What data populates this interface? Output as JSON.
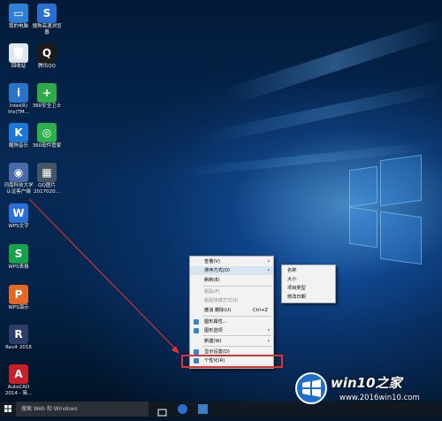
{
  "desktop": {
    "icons": [
      {
        "label": "我的电脑",
        "color": "#2f7fd6",
        "glyph": "▭",
        "icon": "computer-icon"
      },
      {
        "label": "搜狗高速浏览\n器",
        "color": "#2a6fd0",
        "glyph": "S",
        "icon": "sogou-browser-icon"
      },
      {
        "label": "回收站",
        "color": "#dfe6ee",
        "glyph": "🗑",
        "icon": "recycle-bin-icon"
      },
      {
        "label": "腾讯QQ",
        "color": "#1b1b1b",
        "glyph": "Q",
        "icon": "qq-icon"
      },
      {
        "label": "Intel(R)\nIris(TM...",
        "color": "#2a74c8",
        "glyph": "i",
        "icon": "intel-graphics-icon"
      },
      {
        "label": "360安全卫士",
        "color": "#2fa84a",
        "glyph": "+",
        "icon": "360-safe-icon"
      },
      {
        "label": "酷狗音乐",
        "color": "#1c78d6",
        "glyph": "K",
        "icon": "kugou-music-icon"
      },
      {
        "label": "360软件管家",
        "color": "#2fb04c",
        "glyph": "◎",
        "icon": "360-software-icon"
      },
      {
        "label": "河南科技大学\n认证客户端",
        "color": "#4a6aa8",
        "glyph": "◉",
        "icon": "campus-client-icon"
      },
      {
        "label": "QQ图片\n2017020...",
        "color": "#445566",
        "glyph": "▦",
        "icon": "qq-image-icon"
      },
      {
        "label": "WPS文字",
        "color": "#2b6fd8",
        "glyph": "W",
        "icon": "wps-writer-icon"
      },
      {
        "label": "WPS表格",
        "color": "#17a34a",
        "glyph": "S",
        "icon": "wps-spreadsheet-icon"
      },
      {
        "label": "WPS演示",
        "color": "#e2692a",
        "glyph": "P",
        "icon": "wps-presentation-icon"
      },
      {
        "label": "Revit 2016",
        "color": "#2a3e6a",
        "glyph": "R",
        "icon": "revit-icon"
      },
      {
        "label": "AutoCAD\n2014 - 简...",
        "color": "#c8202a",
        "glyph": "A",
        "icon": "autocad-icon"
      }
    ]
  },
  "context_menu": {
    "items": [
      {
        "label": "查看(V)",
        "shortcut": "",
        "submenu": true,
        "disabled": false
      },
      {
        "label": "排序方式(O)",
        "shortcut": "",
        "submenu": true,
        "disabled": false,
        "highlight": true
      },
      {
        "label": "刷新(E)",
        "shortcut": "",
        "submenu": false,
        "disabled": false
      },
      {
        "label": "粘贴(P)",
        "shortcut": "",
        "submenu": false,
        "disabled": true
      },
      {
        "label": "粘贴快捷方式(S)",
        "shortcut": "",
        "submenu": false,
        "disabled": true
      },
      {
        "label": "撤消 删除(U)",
        "shortcut": "Ctrl+Z",
        "submenu": false,
        "disabled": false
      },
      {
        "label": "图形属性...",
        "shortcut": "",
        "submenu": false,
        "disabled": false,
        "icon": true
      },
      {
        "label": "图形选项",
        "shortcut": "",
        "submenu": true,
        "disabled": false,
        "icon": true
      },
      {
        "label": "新建(W)",
        "shortcut": "",
        "submenu": true,
        "disabled": false
      },
      {
        "label": "显示设置(D)",
        "shortcut": "",
        "submenu": false,
        "disabled": false,
        "icon": true
      },
      {
        "label": "个性化(R)",
        "shortcut": "",
        "submenu": false,
        "disabled": false,
        "icon": true
      }
    ],
    "sort_submenu": [
      "名称",
      "大小",
      "项目类型",
      "修改日期"
    ]
  },
  "taskbar": {
    "search_placeholder": "搜索 Web 和 Windows"
  },
  "watermark": {
    "title": "win10之家",
    "url": "www.2016win10.com"
  },
  "colors": {
    "highlight_box": "#e53030",
    "menu_bg": "#f2f2f2",
    "taskbar_bg": "#101822"
  }
}
